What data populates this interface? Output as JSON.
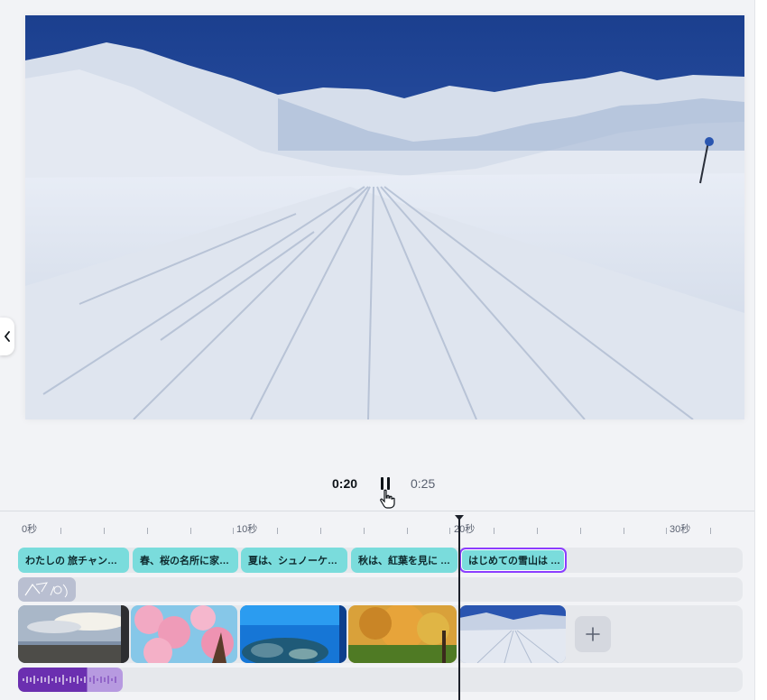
{
  "playback": {
    "current_time": "0:20",
    "total_time": "0:25"
  },
  "ruler": {
    "labels": [
      "0秒",
      "10秒",
      "20秒",
      "30秒"
    ]
  },
  "captions": [
    {
      "text": "わたしの 旅チャン…"
    },
    {
      "text": "春、桜の名所に家…"
    },
    {
      "text": "夏は、シュノーケ…"
    },
    {
      "text": "秋は、紅葉を見に …"
    },
    {
      "text": "はじめての雪山は …"
    }
  ],
  "colors": {
    "caption": "#7adcdc",
    "selected_outline": "#8b3dff",
    "audio": "#6b2fb0",
    "track_bg": "#e6e8ec"
  },
  "icons": {
    "pause": "pause-icon",
    "add": "plus-icon",
    "sidebar_toggle": "chevron-left-icon"
  },
  "add_clip_label": "+"
}
